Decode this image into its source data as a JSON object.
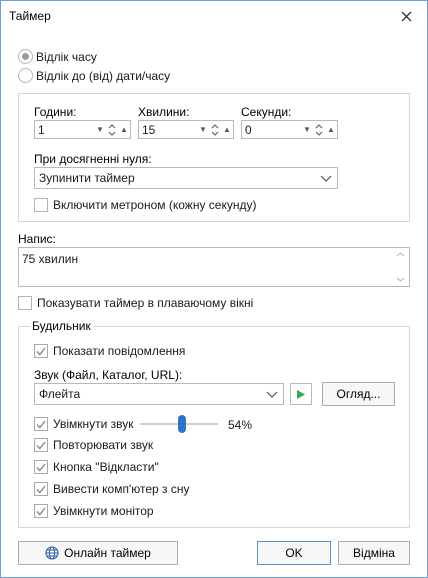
{
  "window": {
    "title": "Таймер"
  },
  "mode": {
    "countdown_label": "Відлік часу",
    "countdown_selected": true,
    "to_date_label": "Відлік до (від) дати/часу",
    "to_date_selected": false
  },
  "timer": {
    "hours_label": "Години:",
    "hours_value": "1",
    "minutes_label": "Хвилини:",
    "minutes_value": "15",
    "seconds_label": "Секунди:",
    "seconds_value": "0",
    "on_zero_label": "При досягненні нуля:",
    "on_zero_value": "Зупинити таймер",
    "metronome_label": "Включити метроном (кожну секунду)",
    "metronome_checked": false
  },
  "caption": {
    "label": "Напис:",
    "value": "75 хвилин"
  },
  "floating": {
    "label": "Показувати таймер в плаваючому вікні",
    "checked": false
  },
  "alarm": {
    "group_title": "Будильник",
    "show_message_label": "Показати повідомлення",
    "show_message_checked": true,
    "sound_label": "Звук (Файл, Каталог, URL):",
    "sound_value": "Флейта",
    "browse_label": "Огляд...",
    "enable_sound_label": "Увімкнути звук",
    "enable_sound_checked": true,
    "volume_percent": 54,
    "volume_text": "54%",
    "repeat_label": "Повторювати звук",
    "repeat_checked": true,
    "snooze_label": "Кнопка \"Відкласти\"",
    "snooze_checked": true,
    "wake_label": "Вивести комп'ютер з сну",
    "wake_checked": true,
    "monitor_label": "Увімкнути монітор",
    "monitor_checked": true
  },
  "footer": {
    "online_label": "Онлайн таймер",
    "ok_label": "OK",
    "cancel_label": "Відміна"
  },
  "colors": {
    "accent": "#2d74c9",
    "play_green": "#2fa84f",
    "check_gray": "#8a8a8a"
  }
}
